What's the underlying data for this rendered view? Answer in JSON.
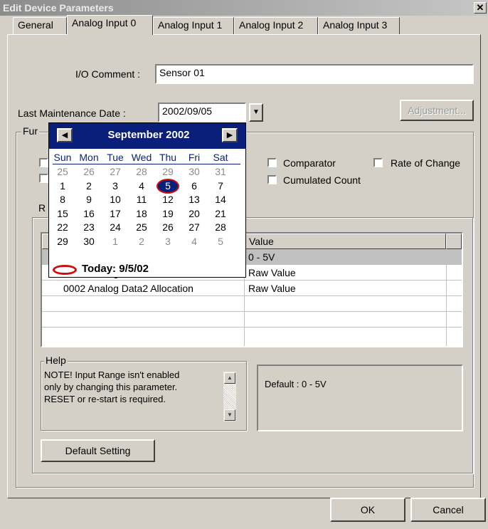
{
  "window": {
    "title": "Edit Device Parameters",
    "close_glyph": "✕"
  },
  "tabs": [
    {
      "label": "General"
    },
    {
      "label": "Analog Input 0"
    },
    {
      "label": "Analog Input 1"
    },
    {
      "label": "Analog Input 2"
    },
    {
      "label": "Analog Input 3"
    }
  ],
  "io_comment": {
    "label": "I/O Comment :",
    "value": "Sensor 01"
  },
  "maintenance": {
    "label": "Last Maintenance Date :",
    "value": "2002/09/05",
    "dropdown_glyph": "▼"
  },
  "adjustment_button": "Adjustment...",
  "function_group": {
    "title_partial": "Fur",
    "checkboxes": [
      {
        "label": "Comparator",
        "checked": false
      },
      {
        "label": "Rate of Change",
        "checked": false
      },
      {
        "label": "Cumulated Count",
        "checked": false
      }
    ]
  },
  "sub_group_partial": "R",
  "table": {
    "headers": [
      "",
      "Value"
    ],
    "rows": [
      {
        "name": "",
        "value": "0 - 5V",
        "selected": true
      },
      {
        "name": "0001 Analog Data1 Allocation",
        "value": "Raw Value",
        "selected": false
      },
      {
        "name": "0002 Analog Data2 Allocation",
        "value": "Raw Value",
        "selected": false
      }
    ]
  },
  "help": {
    "title": "Help",
    "line1": "NOTE! Input Range isn't enabled",
    "line2": "only by changing this parameter.",
    "line3": "RESET or re-start is required.",
    "default_text": "Default : 0 - 5V"
  },
  "default_setting_button": "Default Setting",
  "ok_button": "OK",
  "cancel_button": "Cancel",
  "calendar": {
    "month_title": "September 2002",
    "prev_glyph": "◀",
    "next_glyph": "▶",
    "weekdays": [
      "Sun",
      "Mon",
      "Tue",
      "Wed",
      "Thu",
      "Fri",
      "Sat"
    ],
    "weeks": [
      [
        "25",
        "26",
        "27",
        "28",
        "29",
        "30",
        "31"
      ],
      [
        "1",
        "2",
        "3",
        "4",
        "5",
        "6",
        "7"
      ],
      [
        "8",
        "9",
        "10",
        "11",
        "12",
        "13",
        "14"
      ],
      [
        "15",
        "16",
        "17",
        "18",
        "19",
        "20",
        "21"
      ],
      [
        "22",
        "23",
        "24",
        "25",
        "26",
        "27",
        "28"
      ],
      [
        "29",
        "30",
        "1",
        "2",
        "3",
        "4",
        "5"
      ]
    ],
    "today_label": "Today: 9/5/02",
    "accent": "#0a1f7a",
    "marker_color": "#cc1010"
  }
}
